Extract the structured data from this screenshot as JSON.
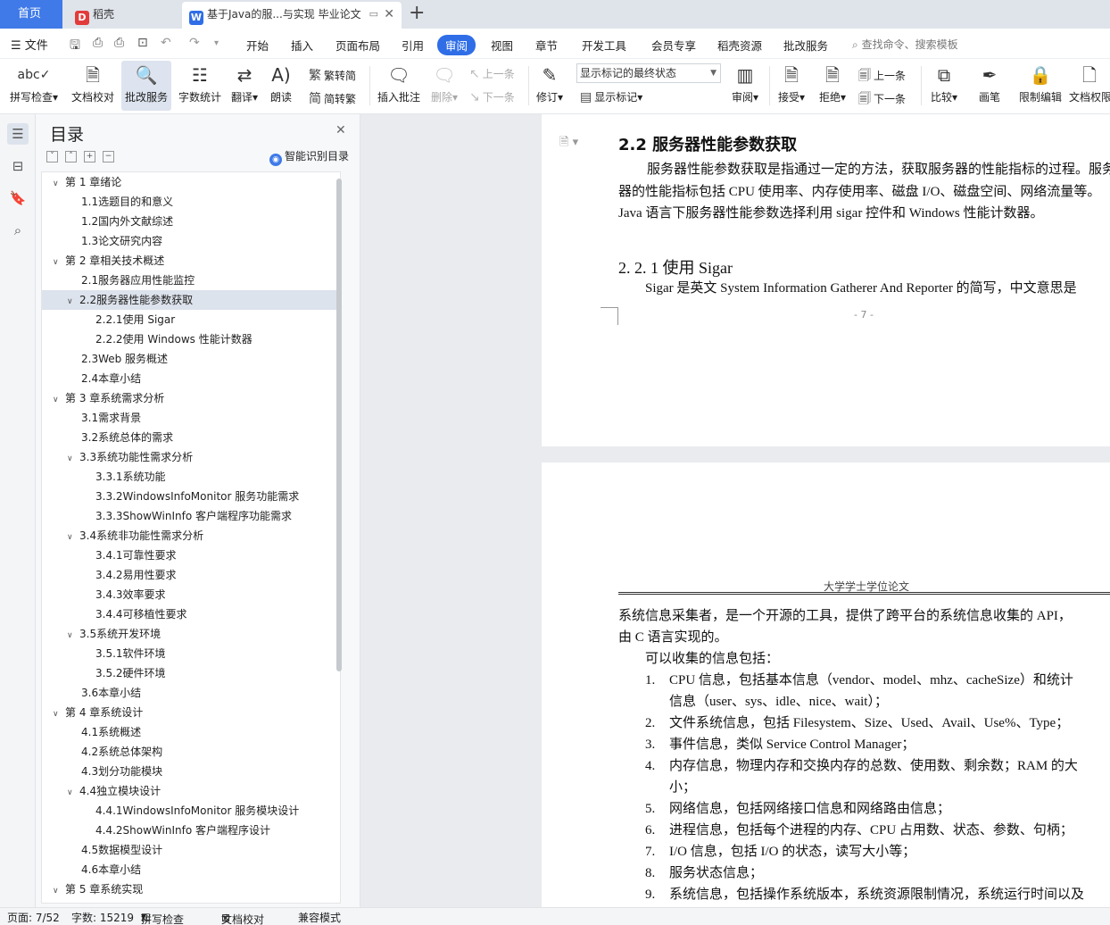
{
  "tabs": {
    "home": "首页",
    "daoke": "稻壳",
    "doc": "基于Java的服...与实现 毕业论文"
  },
  "menu": {
    "file": "文件",
    "items": [
      "开始",
      "插入",
      "页面布局",
      "引用",
      "审阅",
      "视图",
      "章节",
      "开发工具",
      "会员专享",
      "稻壳资源",
      "批改服务"
    ],
    "active_index": 4,
    "search": "查找命令、搜索模板"
  },
  "ribbon": {
    "spell_check": "拼写检查",
    "doc_check": "文档校对",
    "review_service": "批改服务",
    "word_count": "字数统计",
    "translate": "翻译",
    "read_aloud": "朗读",
    "trad_simp_to_trad": "繁转简",
    "trad_simp_to_simp": "简转繁",
    "insert_comment": "插入批注",
    "delete": "删除",
    "prev": "上一条",
    "next": "下一条",
    "track_changes": "修订",
    "markup_state": "显示标记的最终状态",
    "show_markup": "显示标记",
    "review": "审阅",
    "accept": "接受",
    "reject": "拒绝",
    "prev2": "上一条",
    "next2": "下一条",
    "compare": "比较",
    "pen": "画笔",
    "restrict_edit": "限制编辑",
    "doc_permission": "文档权限"
  },
  "toc": {
    "title": "目录",
    "smart": "智能识别目录",
    "items": [
      {
        "level": 1,
        "text": "第 1 章绪论",
        "arrow": "open"
      },
      {
        "level": 2,
        "text": "1.1选题目的和意义"
      },
      {
        "level": 2,
        "text": "1.2国内外文献综述"
      },
      {
        "level": 2,
        "text": "1.3论文研究内容"
      },
      {
        "level": 1,
        "text": "第 2 章相关技术概述",
        "arrow": "open"
      },
      {
        "level": 2,
        "text": "2.1服务器应用性能监控"
      },
      {
        "level": 2,
        "text": "2.2服务器性能参数获取",
        "arrow": "open",
        "selected": true
      },
      {
        "level": 3,
        "text": "2.2.1使用 Sigar"
      },
      {
        "level": 3,
        "text": "2.2.2使用 Windows 性能计数器"
      },
      {
        "level": 2,
        "text": "2.3Web 服务概述"
      },
      {
        "level": 2,
        "text": "2.4本章小结"
      },
      {
        "level": 1,
        "text": "第 3 章系统需求分析",
        "arrow": "open"
      },
      {
        "level": 2,
        "text": "3.1需求背景"
      },
      {
        "level": 2,
        "text": "3.2系统总体的需求"
      },
      {
        "level": 2,
        "text": "3.3系统功能性需求分析",
        "arrow": "open"
      },
      {
        "level": 3,
        "text": "3.3.1系统功能"
      },
      {
        "level": 3,
        "text": "3.3.2WindowsInfoMonitor 服务功能需求"
      },
      {
        "level": 3,
        "text": "3.3.3ShowWinInfo 客户端程序功能需求"
      },
      {
        "level": 2,
        "text": "3.4系统非功能性需求分析",
        "arrow": "open"
      },
      {
        "level": 3,
        "text": "3.4.1可靠性要求"
      },
      {
        "level": 3,
        "text": "3.4.2易用性要求"
      },
      {
        "level": 3,
        "text": "3.4.3效率要求"
      },
      {
        "level": 3,
        "text": "3.4.4可移植性要求"
      },
      {
        "level": 2,
        "text": "3.5系统开发环境",
        "arrow": "open"
      },
      {
        "level": 3,
        "text": "3.5.1软件环境"
      },
      {
        "level": 3,
        "text": "3.5.2硬件环境"
      },
      {
        "level": 2,
        "text": "3.6本章小结"
      },
      {
        "level": 1,
        "text": "第 4 章系统设计",
        "arrow": "open"
      },
      {
        "level": 2,
        "text": "4.1系统概述"
      },
      {
        "level": 2,
        "text": "4.2系统总体架构"
      },
      {
        "level": 2,
        "text": "4.3划分功能模块"
      },
      {
        "level": 2,
        "text": "4.4独立模块设计",
        "arrow": "open"
      },
      {
        "level": 3,
        "text": "4.4.1WindowsInfoMonitor 服务模块设计"
      },
      {
        "level": 3,
        "text": "4.4.2ShowWinInfo 客户端程序设计"
      },
      {
        "level": 2,
        "text": "4.5数据模型设计"
      },
      {
        "level": 2,
        "text": "4.6本章小结"
      },
      {
        "level": 1,
        "text": "第 5 章系统实现",
        "arrow": "open"
      }
    ]
  },
  "document": {
    "page1": {
      "heading": "2.2  服务器性能参数获取",
      "paragraph": "服务器性能参数获取是指通过一定的方法，获取服务器的性能指标的过程。服务器的性能指标包括 CPU 使用率、内存使用率、磁盘 I/O、磁盘空间、网络流量等。Java 语言下服务器性能参数选择利用 sigar 控件和 Windows 性能计数器。",
      "subheading": "2. 2. 1  使用 Sigar",
      "sigar_line": "Sigar 是英文 System Information Gatherer And Reporter 的简写，中文意思是",
      "page_number": "- 7 -"
    },
    "page2": {
      "header": "大学学士学位论文",
      "line1": "系统信息采集者，是一个开源的工具，提供了跨平台的系统信息收集的 API，",
      "line2": "由 C 语言实现的。",
      "line3": "可以收集的信息包括：",
      "list": [
        {
          "n": "1.",
          "text": "CPU 信息，包括基本信息（vendor、model、mhz、cacheSize）和统计",
          "cont": "信息（user、sys、idle、nice、wait）；"
        },
        {
          "n": "2.",
          "text": "文件系统信息，包括 Filesystem、Size、Used、Avail、Use%、Type；"
        },
        {
          "n": "3.",
          "text": "事件信息，类似 Service Control Manager；"
        },
        {
          "n": "4.",
          "text": "内存信息，物理内存和交换内存的总数、使用数、剩余数；RAM 的大",
          "cont": "小；"
        },
        {
          "n": "5.",
          "text": "网络信息，包括网络接口信息和网络路由信息；"
        },
        {
          "n": "6.",
          "text": "进程信息，包括每个进程的内存、CPU 占用数、状态、参数、句柄；"
        },
        {
          "n": "7.",
          "text": "I/O 信息，包括 I/O 的状态，读写大小等；"
        },
        {
          "n": "8.",
          "text": "服务状态信息；"
        },
        {
          "n": "9.",
          "text": "系统信息，包括操作系统版本，系统资源限制情况，系统运行时间以及"
        }
      ]
    }
  },
  "status": {
    "page": "页面: 7/52",
    "words": "字数: 15219",
    "spell": "拼写检查",
    "doccheck": "文档校对",
    "compat": "兼容模式"
  }
}
